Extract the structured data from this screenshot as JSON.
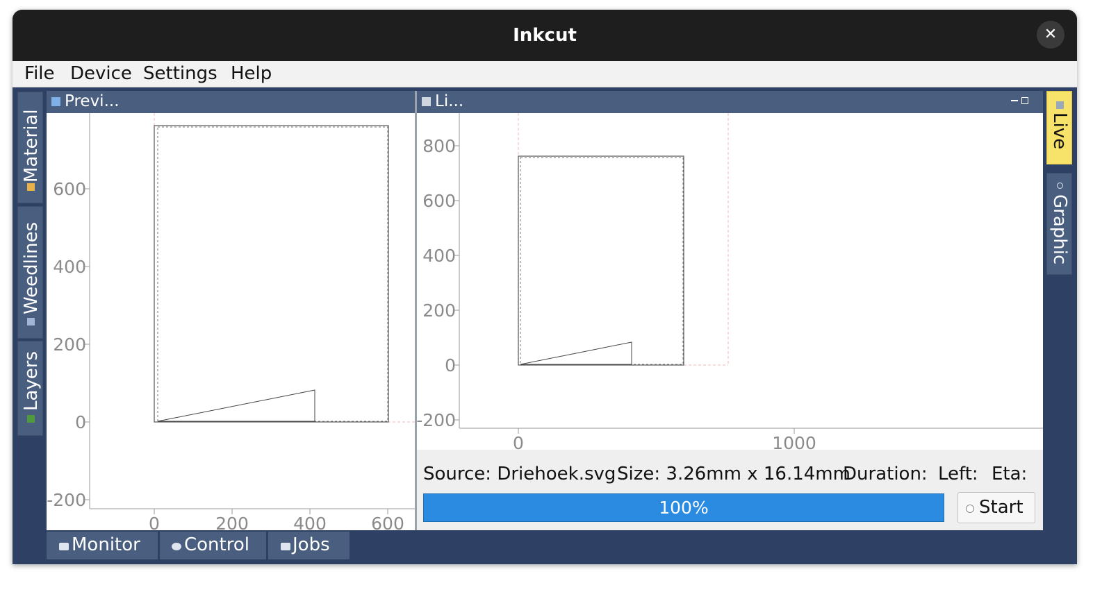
{
  "window": {
    "title": "Inkcut",
    "close_icon": "close-icon"
  },
  "menu": [
    "File",
    "Device",
    "Settings",
    "Help"
  ],
  "left_tabs": [
    "Material",
    "Weedlines",
    "Layers"
  ],
  "right_tabs": [
    "Live",
    "Graphic"
  ],
  "preview_panel": {
    "title": "Previ...",
    "plot": {
      "x_ticks": [
        "0",
        "200",
        "400",
        "600"
      ],
      "y_ticks": [
        "600",
        "400",
        "200",
        "0",
        "-200"
      ],
      "xlim": [
        -165,
        670
      ],
      "ylim": [
        -230,
        790
      ]
    }
  },
  "live_panel": {
    "title": "Li...",
    "plot": {
      "x_ticks": [
        "0",
        "1000"
      ],
      "y_ticks": [
        "800",
        "600",
        "400",
        "200",
        "0",
        "-200"
      ],
      "xlim": [
        -215,
        1920
      ],
      "ylim": [
        -230,
        920
      ]
    }
  },
  "status": {
    "source": "Source: Driehoek.svg",
    "size": "Size: 3.26mm x 16.14mm",
    "duration": "Duration:",
    "left": "Left:",
    "eta": "Eta:"
  },
  "progress": {
    "value": 1.0,
    "label": "100%"
  },
  "start_label": "Start",
  "bottom_tabs": [
    "Monitor",
    "Control",
    "Jobs"
  ],
  "colors": {
    "accent": "#2a8be0",
    "panel": "#2e4063",
    "tab": "#4a5f7f",
    "active_tab": "#f7e36a"
  }
}
